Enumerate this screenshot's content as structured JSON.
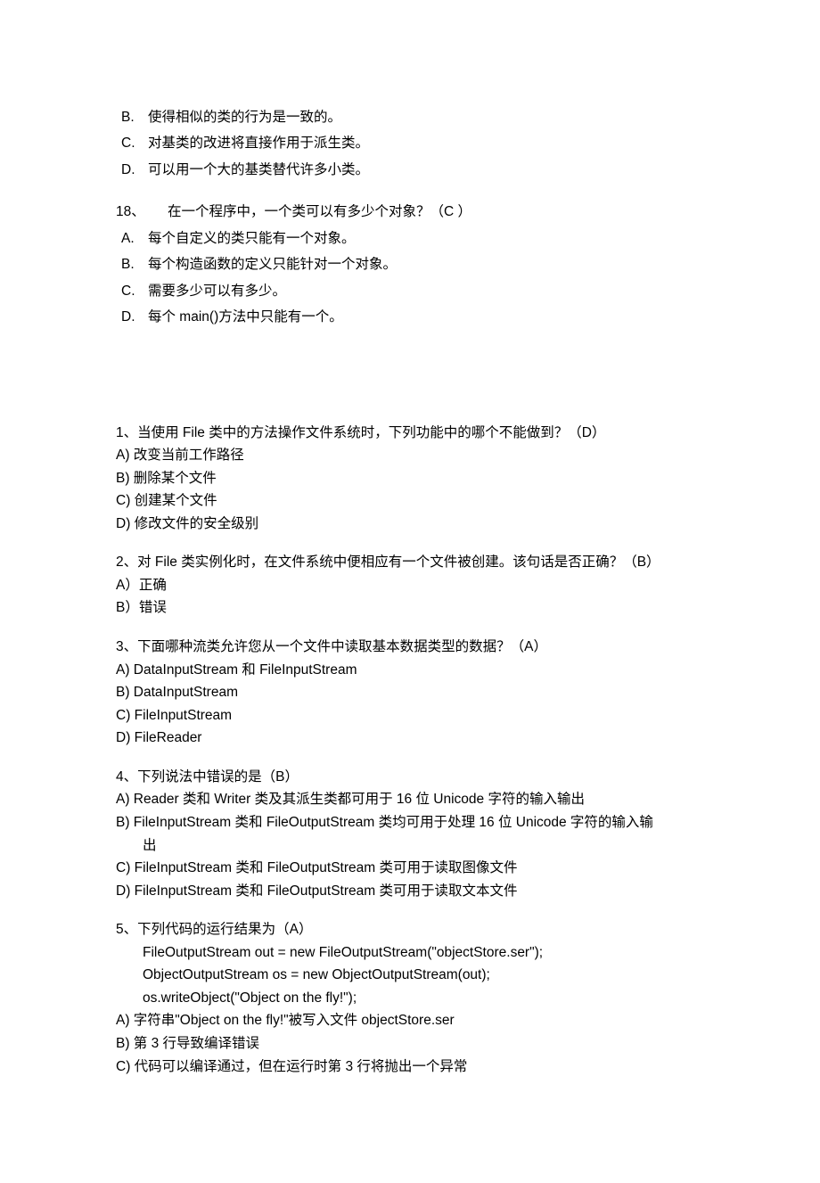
{
  "top": {
    "b": {
      "label": "B.",
      "text": "使得相似的类的行为是一致的。"
    },
    "c": {
      "label": "C.",
      "text": "对基类的改进将直接作用于派生类。"
    },
    "d": {
      "label": "D.",
      "text": "可以用一个大的基类替代许多小类。"
    }
  },
  "q18": {
    "num": "18、",
    "stem": "在一个程序中，一个类可以有多少个对象？（C   ）",
    "a": {
      "label": "A.",
      "text": "每个自定义的类只能有一个对象。"
    },
    "b": {
      "label": "B.",
      "text": "每个构造函数的定义只能针对一个对象。"
    },
    "c": {
      "label": "C.",
      "text": "需要多少可以有多少。"
    },
    "d": {
      "label": "D.",
      "text": "每个 main()方法中只能有一个。"
    }
  },
  "s2": {
    "q1": {
      "stem": "1、当使用 File 类中的方法操作文件系统时，下列功能中的哪个不能做到？（D）",
      "a": "A)  改变当前工作路径",
      "b": "B)  删除某个文件",
      "c": "C)  创建某个文件",
      "d": "D)  修改文件的安全级别"
    },
    "q2": {
      "stem": "2、对 File 类实例化时，在文件系统中便相应有一个文件被创建。该句话是否正确？（B）",
      "a": "A）正确",
      "b": "B）错误"
    },
    "q3": {
      "stem": "3、下面哪种流类允许您从一个文件中读取基本数据类型的数据？（A）",
      "a": "A)  DataInputStream 和 FileInputStream",
      "b": "B)  DataInputStream",
      "c": "C)  FileInputStream",
      "d": "D)  FileReader"
    },
    "q4": {
      "stem": "4、下列说法中错误的是（B）",
      "a": "A)  Reader 类和 Writer 类及其派生类都可用于 16 位 Unicode 字符的输入输出",
      "b1": "B)  FileInputStream 类和 FileOutputStream 类均可用于处理 16 位 Unicode 字符的输入输",
      "b2": "出",
      "c": "C)  FileInputStream 类和 FileOutputStream 类可用于读取图像文件",
      "d": "D)  FileInputStream 类和 FileOutputStream 类可用于读取文本文件"
    },
    "q5": {
      "stem": "5、下列代码的运行结果为（A）",
      "code1": "FileOutputStream out = new FileOutputStream(\"objectStore.ser\");",
      "code2": "ObjectOutputStream os = new ObjectOutputStream(out);",
      "code3": "os.writeObject(\"Object on the fly!\");",
      "a": "A)  字符串\"Object on the fly!\"被写入文件 objectStore.ser",
      "b": "B)  第 3 行导致编译错误",
      "c": "C)  代码可以编译通过，但在运行时第 3 行将抛出一个异常"
    }
  }
}
